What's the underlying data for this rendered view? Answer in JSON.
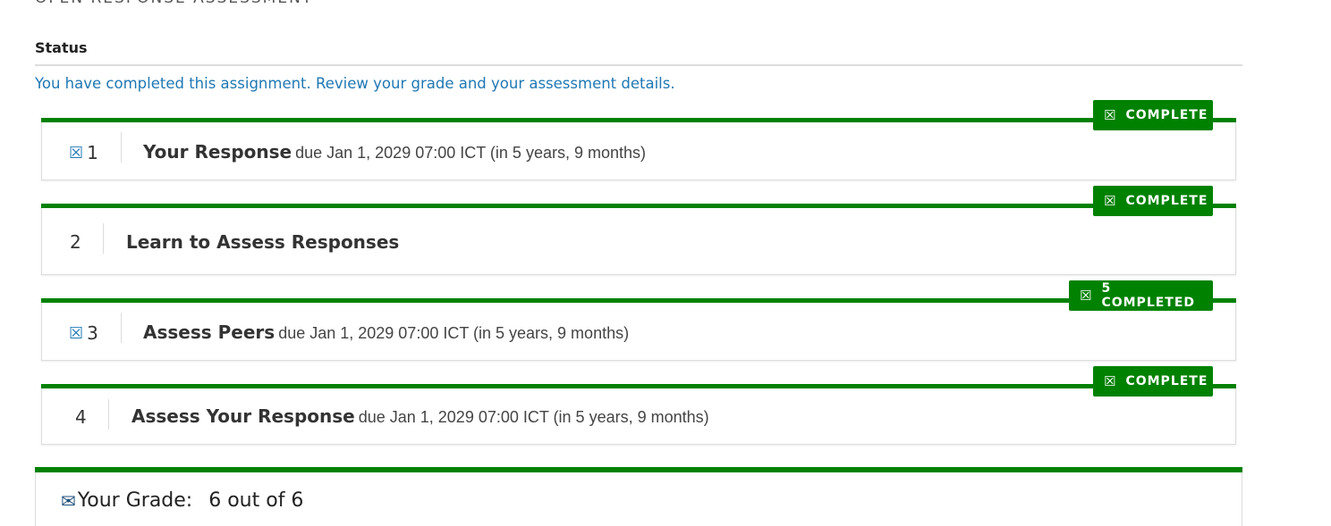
{
  "header": {
    "title": "OPEN RESPONSE ASSESSMENT",
    "status_heading": "Status",
    "status_message": "You have completed this assignment. Review your grade and your assessment details."
  },
  "steps": [
    {
      "number": "1",
      "label": "Your Response",
      "due": "due Jan 1, 2029 07:00 ICT (in 5 years, 9 months)",
      "badge": "COMPLETE",
      "icon": "check-square-icon"
    },
    {
      "number": "2",
      "label": "Learn to Assess Responses",
      "due": "",
      "badge": "COMPLETE",
      "icon": ""
    },
    {
      "number": "3",
      "label": "Assess Peers",
      "due": "due Jan 1, 2029 07:00 ICT (in 5 years, 9 months)",
      "badge": "5 COMPLETED",
      "icon": "check-square-icon"
    },
    {
      "number": "4",
      "label": "Assess Your Response",
      "due": "due Jan 1, 2029 07:00 ICT (in 5 years, 9 months)",
      "badge": "COMPLETE",
      "icon": ""
    }
  ],
  "grade": {
    "label": "Your Grade:",
    "value": "6 out of 6",
    "icon": "envelope-icon"
  },
  "colors": {
    "accent_green": "#008100",
    "link_blue": "#1f78b4"
  }
}
